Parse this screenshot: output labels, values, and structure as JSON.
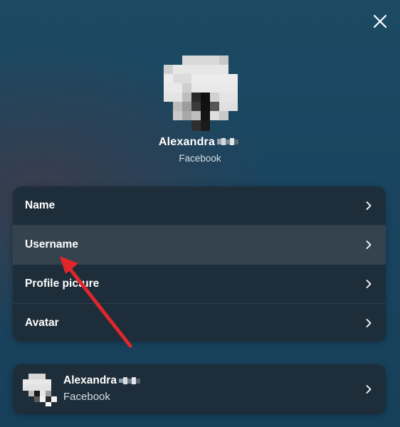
{
  "header": {
    "close_icon": "close-icon"
  },
  "profile": {
    "name": "Alexandra",
    "source": "Facebook"
  },
  "menu": {
    "items": [
      {
        "label": "Name",
        "active": false
      },
      {
        "label": "Username",
        "active": true
      },
      {
        "label": "Profile picture",
        "active": false
      },
      {
        "label": "Avatar",
        "active": false
      }
    ]
  },
  "account": {
    "name": "Alexandra",
    "source": "Facebook"
  },
  "colors": {
    "background_top": "#1c4a63",
    "card": "#1d2d39",
    "active_row": "#34434e",
    "annotation_arrow": "#e0262b"
  }
}
